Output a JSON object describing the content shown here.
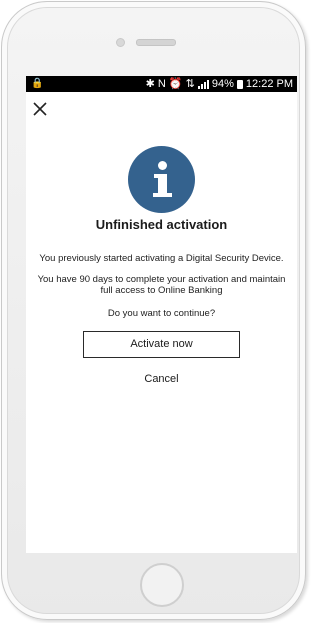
{
  "status_bar": {
    "left_icon": "lock-icon",
    "indicators": "✱ N ⏰ ⇅",
    "battery": "94%",
    "time": "12:22 PM"
  },
  "dialog": {
    "close_icon": "close-icon",
    "info_icon": "info-icon",
    "title": "Unfinished activation",
    "paragraph_1": "You previously started activating a Digital Security Device.",
    "paragraph_2": "You have 90 days to complete your activation and maintain full access to Online Banking",
    "question": "Do you want to continue?",
    "activate_label": "Activate now",
    "cancel_label": "Cancel"
  },
  "colors": {
    "accent": "#34628e",
    "status_bar": "#000000"
  }
}
